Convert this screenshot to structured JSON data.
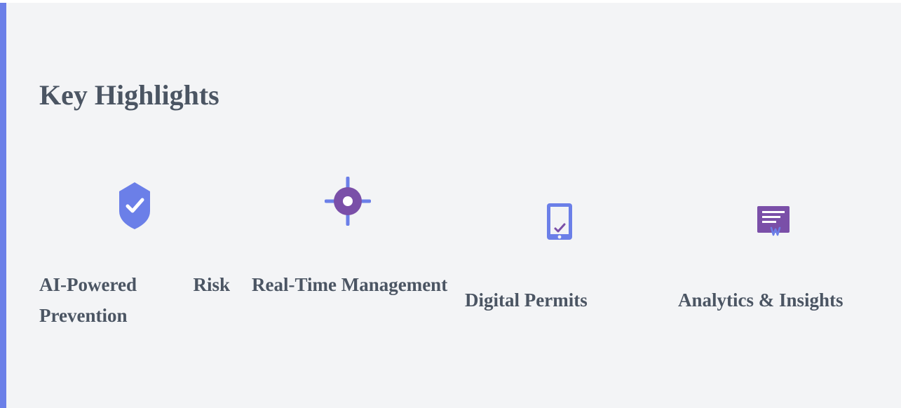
{
  "section": {
    "title": "Key Highlights"
  },
  "colors": {
    "accent_blue": "#6b7fe8",
    "accent_purple": "#7a4fa8",
    "text": "#4b5563",
    "background": "#f3f4f6"
  },
  "features": [
    {
      "label": "AI-Powered Risk Prevention",
      "icon": "shield-check-icon"
    },
    {
      "label": "Real-Time Management",
      "icon": "crosshair-icon"
    },
    {
      "label": "Digital Permits",
      "icon": "tablet-check-icon"
    },
    {
      "label": "Analytics & Insights",
      "icon": "certificate-icon"
    }
  ]
}
